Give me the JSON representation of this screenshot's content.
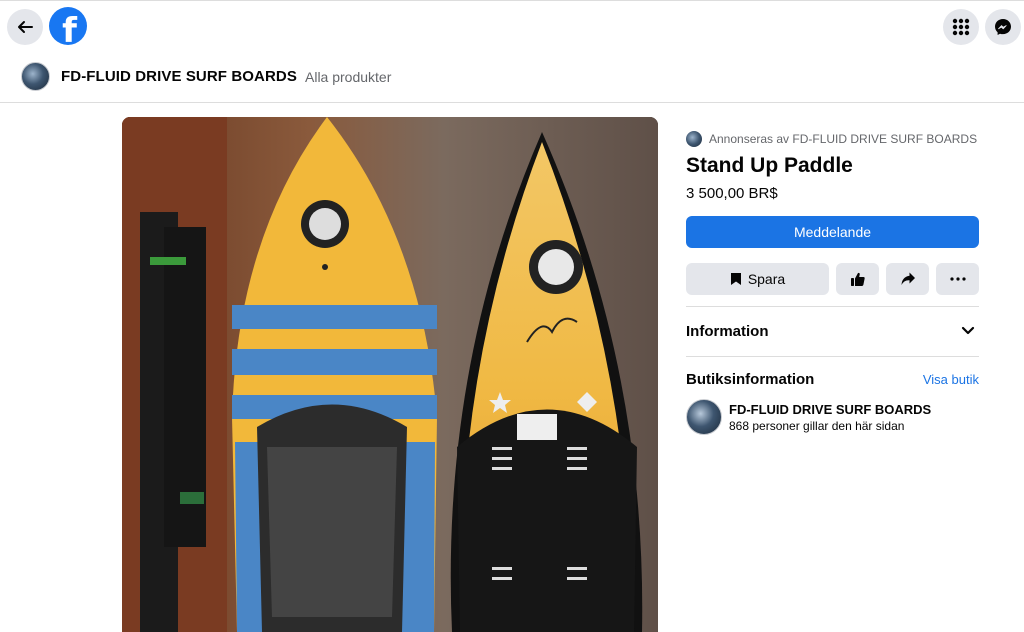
{
  "topbar": {
    "back_icon": "arrow-left-icon",
    "logo_icon": "facebook-logo-icon",
    "logo_letter": "f",
    "apps_icon": "grid-menu-icon",
    "messenger_icon": "messenger-icon"
  },
  "shop": {
    "name": "FD-FLUID DRIVE SURF BOARDS",
    "nav_link": "Alla produkter"
  },
  "listing": {
    "advertised_by": "Annonseras av FD-FLUID DRIVE SURF BOARDS",
    "title": "Stand Up Paddle",
    "price": "3 500,00 BR$",
    "message_button": "Meddelande",
    "save_button": "Spara",
    "info_label": "Information",
    "shop_info_label": "Butiksinformation",
    "visit_shop_link": "Visa butik",
    "seller_name": "FD-FLUID DRIVE SURF BOARDS",
    "seller_likes": "868 personer gillar den här sidan"
  },
  "colors": {
    "primary": "#1b74e4",
    "button_gray": "#e4e6eb",
    "secondary_text": "#65676b"
  }
}
